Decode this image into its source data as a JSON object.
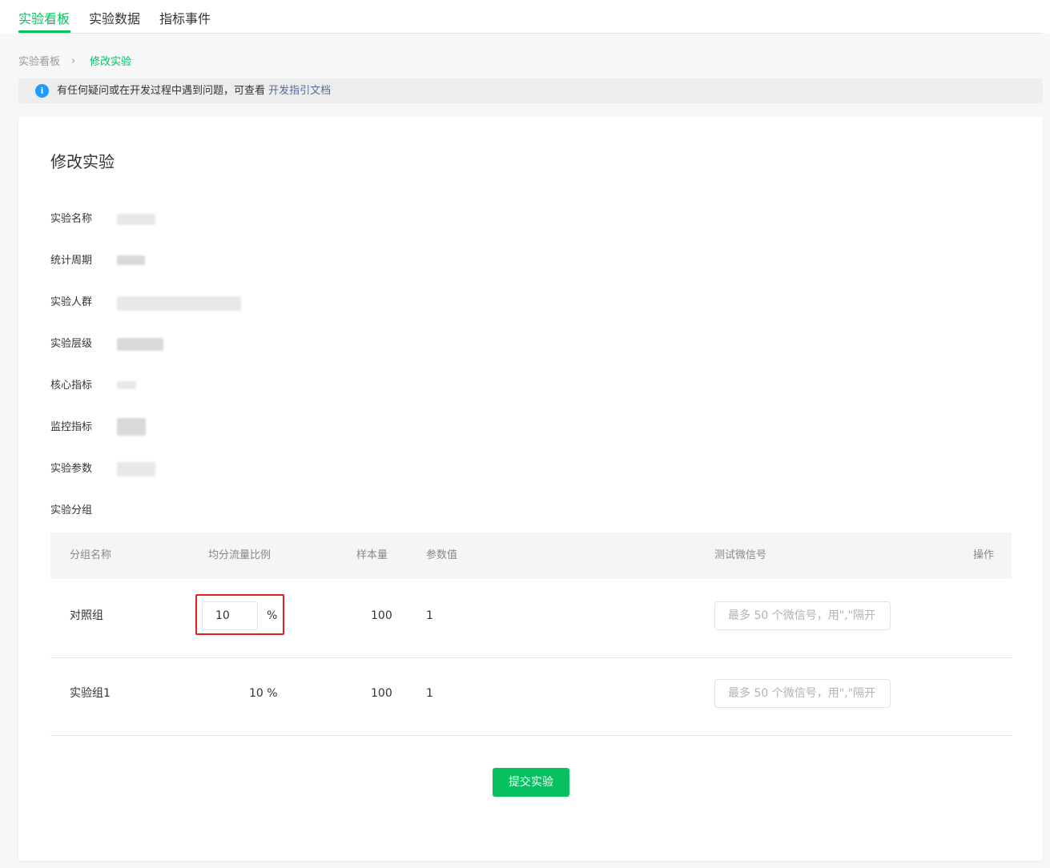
{
  "tabs": [
    {
      "label": "实验看板",
      "active": true
    },
    {
      "label": "实验数据",
      "active": false
    },
    {
      "label": "指标事件",
      "active": false
    }
  ],
  "breadcrumb": {
    "home": "实验看板",
    "separator": "›",
    "current": "修改实验"
  },
  "notice": {
    "icon": "info-icon",
    "text": "有任何疑问或在开发过程中遇到问题，可查看 ",
    "link": "开发指引文档"
  },
  "page_title": "修改实验",
  "fields": [
    {
      "label": "实验名称"
    },
    {
      "label": "统计周期"
    },
    {
      "label": "实验人群"
    },
    {
      "label": "实验层级"
    },
    {
      "label": "核心指标"
    },
    {
      "label": "监控指标"
    },
    {
      "label": "实验参数"
    },
    {
      "label": "实验分组"
    }
  ],
  "table": {
    "headers": [
      "分组名称",
      "均分流量比例",
      "样本量",
      "参数值",
      "测试微信号",
      "操作"
    ],
    "rows": [
      {
        "name": "对照组",
        "ratio_value": "10",
        "ratio_unit": "%",
        "sample": "100",
        "param": "1",
        "wx_placeholder": "最多 50 个微信号，用\",\"隔开"
      },
      {
        "name": "实验组1",
        "ratio_text": "10 %",
        "sample": "100",
        "param": "1",
        "wx_placeholder": "最多 50 个微信号，用\",\"隔开"
      }
    ]
  },
  "submit_label": "提交实验",
  "colors": {
    "accent": "#07c160",
    "link": "#576b95",
    "info": "#1e9bff",
    "highlight": "#e02020"
  }
}
